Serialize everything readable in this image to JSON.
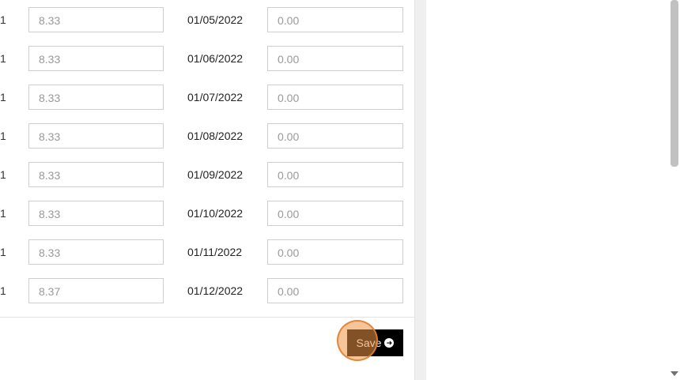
{
  "rows": [
    {
      "lead": "1",
      "amount": "8.33",
      "date": "01/05/2022",
      "value": "0.00"
    },
    {
      "lead": "1",
      "amount": "8.33",
      "date": "01/06/2022",
      "value": "0.00"
    },
    {
      "lead": "1",
      "amount": "8.33",
      "date": "01/07/2022",
      "value": "0.00"
    },
    {
      "lead": "1",
      "amount": "8.33",
      "date": "01/08/2022",
      "value": "0.00"
    },
    {
      "lead": "1",
      "amount": "8.33",
      "date": "01/09/2022",
      "value": "0.00"
    },
    {
      "lead": "1",
      "amount": "8.33",
      "date": "01/10/2022",
      "value": "0.00"
    },
    {
      "lead": "1",
      "amount": "8.33",
      "date": "01/11/2022",
      "value": "0.00"
    },
    {
      "lead": "1",
      "amount": "8.37",
      "date": "01/12/2022",
      "value": "0.00"
    }
  ],
  "save_button": {
    "label": "Save",
    "icon": "arrow-circle-right-icon"
  }
}
